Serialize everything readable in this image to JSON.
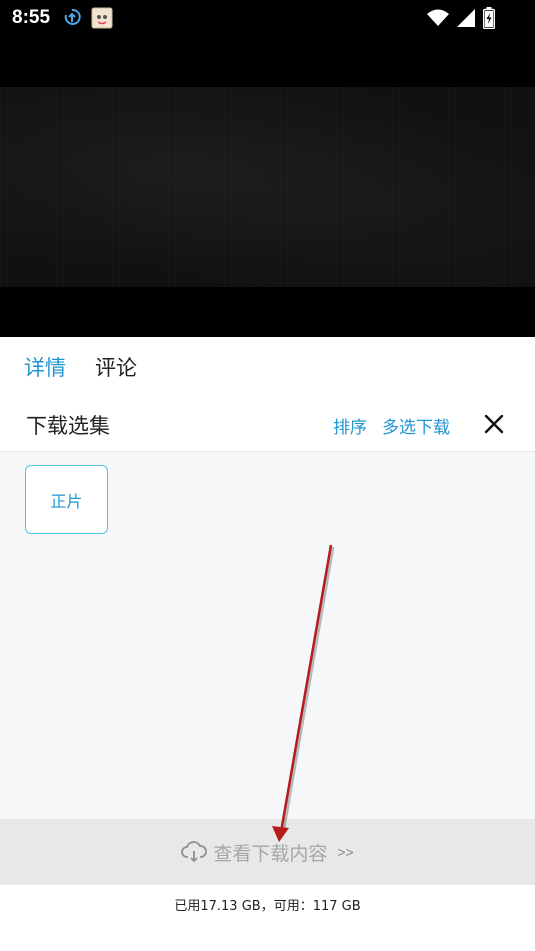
{
  "status_bar": {
    "time": "8:55"
  },
  "tabs": {
    "details": "详情",
    "comments": "评论"
  },
  "download_panel": {
    "title": "下载选集",
    "sort": "排序",
    "multi_select": "多选下载"
  },
  "episodes": [
    {
      "label": "正片"
    }
  ],
  "view_downloads": {
    "label": "查看下载内容",
    "arrows": ">>"
  },
  "storage": {
    "text": "已用17.13 GB，可用：117 GB"
  },
  "colors": {
    "accent": "#2196d3",
    "episode_border": "#4fc3e8",
    "annotation_arrow": "#b71c1c"
  }
}
